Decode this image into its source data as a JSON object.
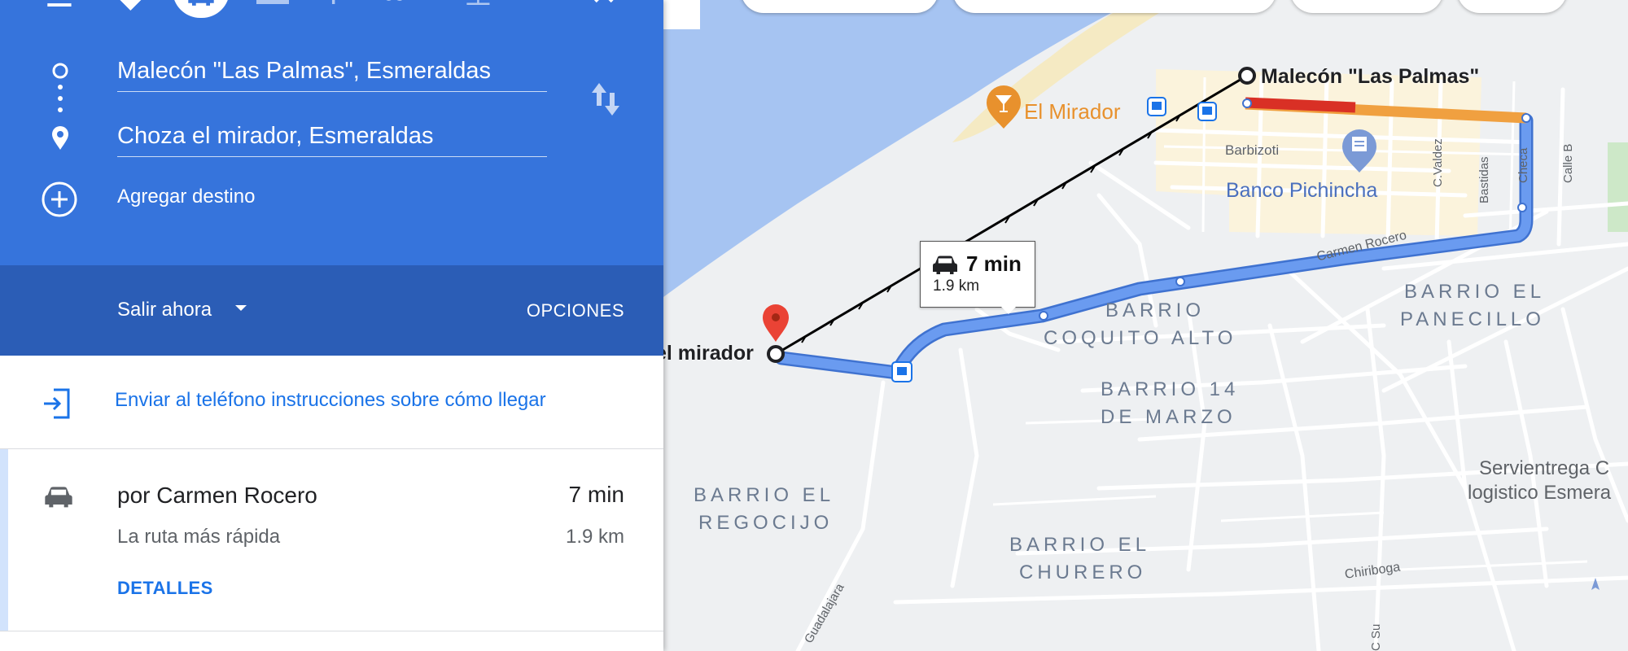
{
  "panel": {
    "origin_value": "Malecón \"Las Palmas\", Esmeraldas",
    "destination_value": "Choza el mirador, Esmeraldas",
    "add_destination_label": "Agregar destino",
    "depart_label": "Salir ahora",
    "options_label": "OPCIONES",
    "send_to_phone_label": "Enviar al teléfono instrucciones sobre cómo llegar",
    "route": {
      "title": "por Carmen Rocero",
      "subtitle": "La ruta más rápida",
      "time": "7 min",
      "distance": "1.9 km",
      "details_label": "DETALLES"
    }
  },
  "map": {
    "callout": {
      "time": "7 min",
      "distance": "1.9 km"
    },
    "origin_label": "Malecón \"Las Palmas\"",
    "destination_label": "el mirador",
    "poi_el_mirador": "El Mirador",
    "poi_banco": "Banco Pichincha",
    "street_barbizoti": "Barbizoti",
    "street_carmen_rocero": "Carmen Rocero",
    "street_c_valdez": "C.Valdez",
    "street_bastidas": "Bastidas",
    "street_checa": "Checa",
    "street_calle_b": "Calle B",
    "street_chiriboga": "Chiriboga",
    "street_guadalajara": "Guadalajara",
    "street_c_su": "C Su",
    "barrio_coquito_1": "BARRIO",
    "barrio_coquito_2": "COQUITO ALTO",
    "barrio_panecillo_1": "BARRIO EL",
    "barrio_panecillo_2": "PANECILLO",
    "barrio_14_1": "BARRIO 14",
    "barrio_14_2": "DE MARZO",
    "barrio_regocijo_1": "BARRIO EL",
    "barrio_regocijo_2": "REGOCIJO",
    "barrio_churero_1": "BARRIO EL",
    "barrio_churero_2": "CHURERO",
    "servientrega_1": "Servientrega C",
    "servientrega_2": "logistico Esmera"
  },
  "colors": {
    "panel_blue": "#3674dc",
    "panel_blue_dark": "#2b5db6",
    "route_blue": "#5a8de8",
    "traffic_red": "#d93025",
    "traffic_orange": "#f0a040",
    "link_blue": "#1a73e8",
    "water": "#a6c4f2",
    "poi_orange": "#e8912d"
  }
}
